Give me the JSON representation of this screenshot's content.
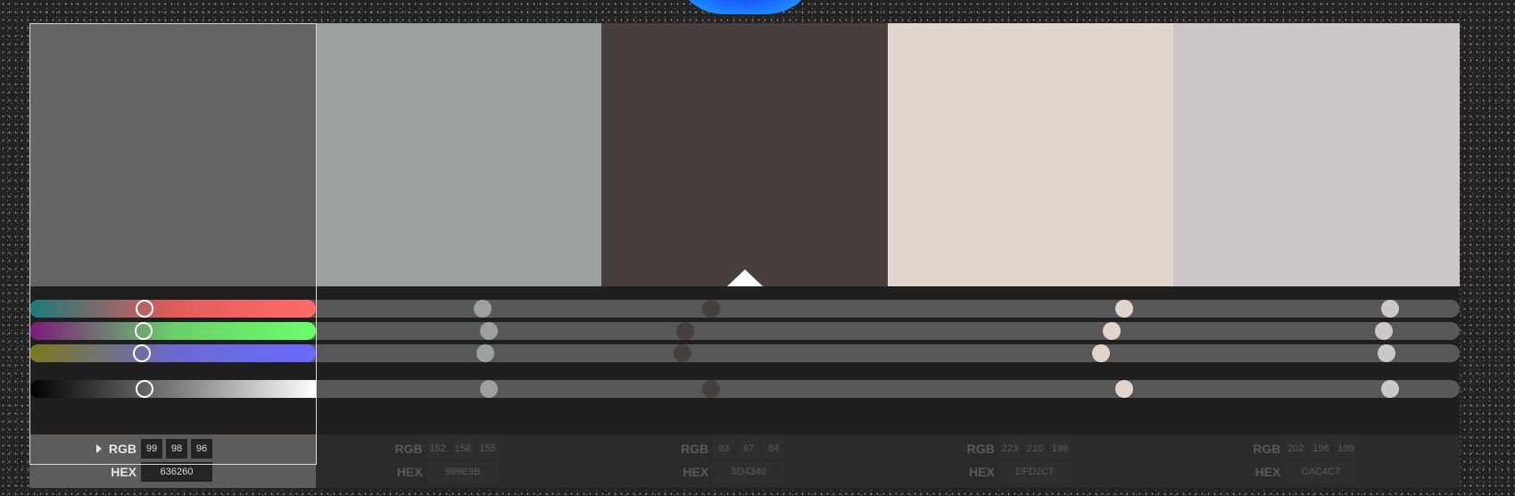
{
  "palette": {
    "active_index": 0,
    "labels": {
      "rgb": "RGB",
      "hex": "HEX"
    },
    "swatches": [
      {
        "hex": "#636260",
        "rgb": [
          "99",
          "98",
          "96"
        ],
        "hex_label": "636260"
      },
      {
        "hex": "#989E9B",
        "rgb": [
          "152",
          "158",
          "155"
        ],
        "hex_label": "989E9B"
      },
      {
        "hex": "#5D4340",
        "rgb": [
          "93",
          "67",
          "64"
        ],
        "hex_label": "5D4340"
      },
      {
        "hex": "#DFD2C7",
        "rgb": [
          "223",
          "210",
          "199"
        ],
        "hex_label": "DFD2C7"
      },
      {
        "hex": "#CAC4C7",
        "rgb": [
          "202",
          "196",
          "199"
        ],
        "hex_label": "CAC4C7"
      }
    ],
    "display_colors": [
      "#666563",
      "#9aa19e",
      "#463f3b",
      "#e2d6cc",
      "#cdc7ca"
    ],
    "slider_values": [
      {
        "r": 0.389,
        "g": 0.384,
        "b": 0.376,
        "l": 0.389
      },
      {
        "r": 0.596,
        "g": 0.62,
        "b": 0.608,
        "l": 0.62
      },
      {
        "r": 0.365,
        "g": 0.263,
        "b": 0.251,
        "l": 0.365
      },
      {
        "r": 0.875,
        "g": 0.824,
        "b": 0.78,
        "l": 0.875
      },
      {
        "r": 0.792,
        "g": 0.769,
        "b": 0.78,
        "l": 0.792
      }
    ]
  },
  "accent_pointer": "#ffffff"
}
